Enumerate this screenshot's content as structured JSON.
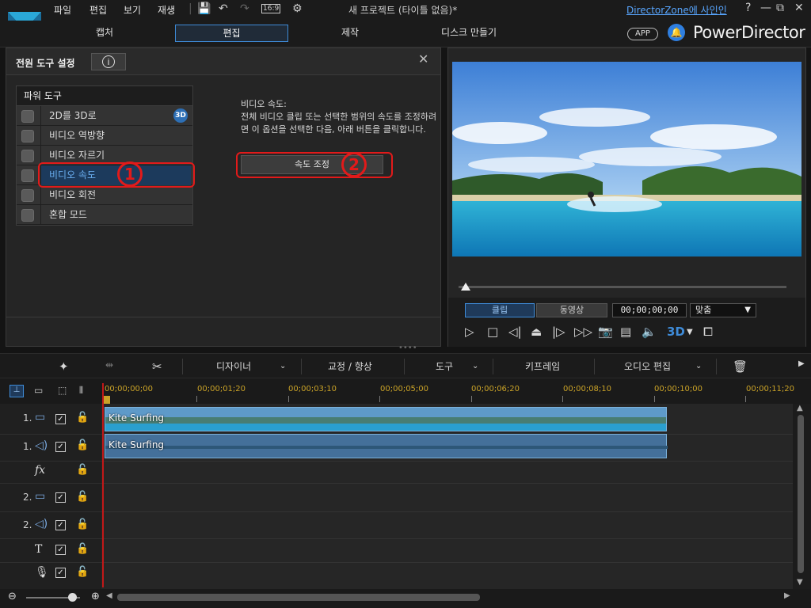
{
  "titlebar": {
    "menu": [
      "파일",
      "편집",
      "보기",
      "재생"
    ],
    "doc_title": "새 프로젝트 (타이틀 없음)*",
    "directorzone_link": "DirectorZone에 사인인",
    "aspect_label": "16:9"
  },
  "tabs": [
    {
      "label": "캡처",
      "active": false
    },
    {
      "label": "편집",
      "active": true
    },
    {
      "label": "제작",
      "active": false
    },
    {
      "label": "디스크 만들기",
      "active": false
    }
  ],
  "app_button": "APP",
  "brand": "PowerDirector",
  "power_tools_panel": {
    "title": "전원 도구 설정",
    "list_header": "파워 도구",
    "items": [
      {
        "label": "2D를 3D로",
        "checked": false,
        "badge": "3D"
      },
      {
        "label": "비디오 역방향",
        "checked": false
      },
      {
        "label": "비디오 자르기",
        "checked": false
      },
      {
        "label": "비디오 속도",
        "checked": false,
        "selected": true
      },
      {
        "label": "비디오 회전",
        "checked": false
      },
      {
        "label": "혼합 모드",
        "checked": false
      }
    ],
    "description_title": "비디오 속도:",
    "description_body": "전체 비디오 클립 또는 선택한 범위의 속도를 조정하려면 이 옵션을 선택한 다음, 아래 버튼을 클릭합니다.",
    "speed_button": "속도 조정",
    "callout_1": "1",
    "callout_2": "2"
  },
  "preview": {
    "clip_button": "클립",
    "movie_button": "동영상",
    "timecode": "00;00;00;00",
    "fit_select": "맞춤",
    "badge_3d": "3D"
  },
  "timeline_toolbar": {
    "designer": "디자이너",
    "fix_enhance": "교정 / 향상",
    "tools": "도구",
    "keyframe": "키프레임",
    "audio_edit": "오디오 편집"
  },
  "ruler": [
    "00;00;00;00",
    "00;00;01;20",
    "00;00;03;10",
    "00;00;05;00",
    "00;00;06;20",
    "00;00;08;10",
    "00;00;10;00",
    "00;00;11;20"
  ],
  "tracks": [
    {
      "num": "1.",
      "type": "video"
    },
    {
      "num": "1.",
      "type": "audio"
    },
    {
      "num": "",
      "type": "fx"
    },
    {
      "num": "2.",
      "type": "video"
    },
    {
      "num": "2.",
      "type": "audio"
    },
    {
      "num": "",
      "type": "title"
    },
    {
      "num": "",
      "type": "voice"
    }
  ],
  "clips": {
    "video_label": "Kite Surfing",
    "audio_label": "Kite Surfing"
  },
  "colors": {
    "accent": "#3e8bd8",
    "callout": "#e21a1a",
    "selected_text": "#6aaef0",
    "playhead": "#c21818"
  }
}
